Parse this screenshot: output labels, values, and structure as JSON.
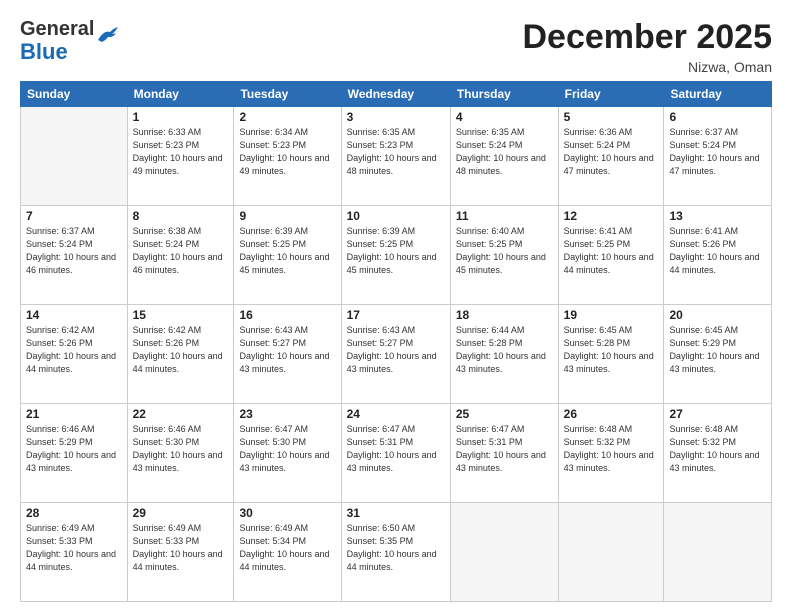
{
  "header": {
    "logo_line1": "General",
    "logo_line2": "Blue",
    "month_title": "December 2025",
    "location": "Nizwa, Oman"
  },
  "weekdays": [
    "Sunday",
    "Monday",
    "Tuesday",
    "Wednesday",
    "Thursday",
    "Friday",
    "Saturday"
  ],
  "weeks": [
    [
      {
        "day": "",
        "empty": true
      },
      {
        "day": "1",
        "sunrise": "6:33 AM",
        "sunset": "5:23 PM",
        "daylight": "10 hours and 49 minutes."
      },
      {
        "day": "2",
        "sunrise": "6:34 AM",
        "sunset": "5:23 PM",
        "daylight": "10 hours and 49 minutes."
      },
      {
        "day": "3",
        "sunrise": "6:35 AM",
        "sunset": "5:23 PM",
        "daylight": "10 hours and 48 minutes."
      },
      {
        "day": "4",
        "sunrise": "6:35 AM",
        "sunset": "5:24 PM",
        "daylight": "10 hours and 48 minutes."
      },
      {
        "day": "5",
        "sunrise": "6:36 AM",
        "sunset": "5:24 PM",
        "daylight": "10 hours and 47 minutes."
      },
      {
        "day": "6",
        "sunrise": "6:37 AM",
        "sunset": "5:24 PM",
        "daylight": "10 hours and 47 minutes."
      }
    ],
    [
      {
        "day": "7",
        "sunrise": "6:37 AM",
        "sunset": "5:24 PM",
        "daylight": "10 hours and 46 minutes."
      },
      {
        "day": "8",
        "sunrise": "6:38 AM",
        "sunset": "5:24 PM",
        "daylight": "10 hours and 46 minutes."
      },
      {
        "day": "9",
        "sunrise": "6:39 AM",
        "sunset": "5:25 PM",
        "daylight": "10 hours and 45 minutes."
      },
      {
        "day": "10",
        "sunrise": "6:39 AM",
        "sunset": "5:25 PM",
        "daylight": "10 hours and 45 minutes."
      },
      {
        "day": "11",
        "sunrise": "6:40 AM",
        "sunset": "5:25 PM",
        "daylight": "10 hours and 45 minutes."
      },
      {
        "day": "12",
        "sunrise": "6:41 AM",
        "sunset": "5:25 PM",
        "daylight": "10 hours and 44 minutes."
      },
      {
        "day": "13",
        "sunrise": "6:41 AM",
        "sunset": "5:26 PM",
        "daylight": "10 hours and 44 minutes."
      }
    ],
    [
      {
        "day": "14",
        "sunrise": "6:42 AM",
        "sunset": "5:26 PM",
        "daylight": "10 hours and 44 minutes."
      },
      {
        "day": "15",
        "sunrise": "6:42 AM",
        "sunset": "5:26 PM",
        "daylight": "10 hours and 44 minutes."
      },
      {
        "day": "16",
        "sunrise": "6:43 AM",
        "sunset": "5:27 PM",
        "daylight": "10 hours and 43 minutes."
      },
      {
        "day": "17",
        "sunrise": "6:43 AM",
        "sunset": "5:27 PM",
        "daylight": "10 hours and 43 minutes."
      },
      {
        "day": "18",
        "sunrise": "6:44 AM",
        "sunset": "5:28 PM",
        "daylight": "10 hours and 43 minutes."
      },
      {
        "day": "19",
        "sunrise": "6:45 AM",
        "sunset": "5:28 PM",
        "daylight": "10 hours and 43 minutes."
      },
      {
        "day": "20",
        "sunrise": "6:45 AM",
        "sunset": "5:29 PM",
        "daylight": "10 hours and 43 minutes."
      }
    ],
    [
      {
        "day": "21",
        "sunrise": "6:46 AM",
        "sunset": "5:29 PM",
        "daylight": "10 hours and 43 minutes."
      },
      {
        "day": "22",
        "sunrise": "6:46 AM",
        "sunset": "5:30 PM",
        "daylight": "10 hours and 43 minutes."
      },
      {
        "day": "23",
        "sunrise": "6:47 AM",
        "sunset": "5:30 PM",
        "daylight": "10 hours and 43 minutes."
      },
      {
        "day": "24",
        "sunrise": "6:47 AM",
        "sunset": "5:31 PM",
        "daylight": "10 hours and 43 minutes."
      },
      {
        "day": "25",
        "sunrise": "6:47 AM",
        "sunset": "5:31 PM",
        "daylight": "10 hours and 43 minutes."
      },
      {
        "day": "26",
        "sunrise": "6:48 AM",
        "sunset": "5:32 PM",
        "daylight": "10 hours and 43 minutes."
      },
      {
        "day": "27",
        "sunrise": "6:48 AM",
        "sunset": "5:32 PM",
        "daylight": "10 hours and 43 minutes."
      }
    ],
    [
      {
        "day": "28",
        "sunrise": "6:49 AM",
        "sunset": "5:33 PM",
        "daylight": "10 hours and 44 minutes."
      },
      {
        "day": "29",
        "sunrise": "6:49 AM",
        "sunset": "5:33 PM",
        "daylight": "10 hours and 44 minutes."
      },
      {
        "day": "30",
        "sunrise": "6:49 AM",
        "sunset": "5:34 PM",
        "daylight": "10 hours and 44 minutes."
      },
      {
        "day": "31",
        "sunrise": "6:50 AM",
        "sunset": "5:35 PM",
        "daylight": "10 hours and 44 minutes."
      },
      {
        "day": "",
        "empty": true
      },
      {
        "day": "",
        "empty": true
      },
      {
        "day": "",
        "empty": true
      }
    ]
  ]
}
